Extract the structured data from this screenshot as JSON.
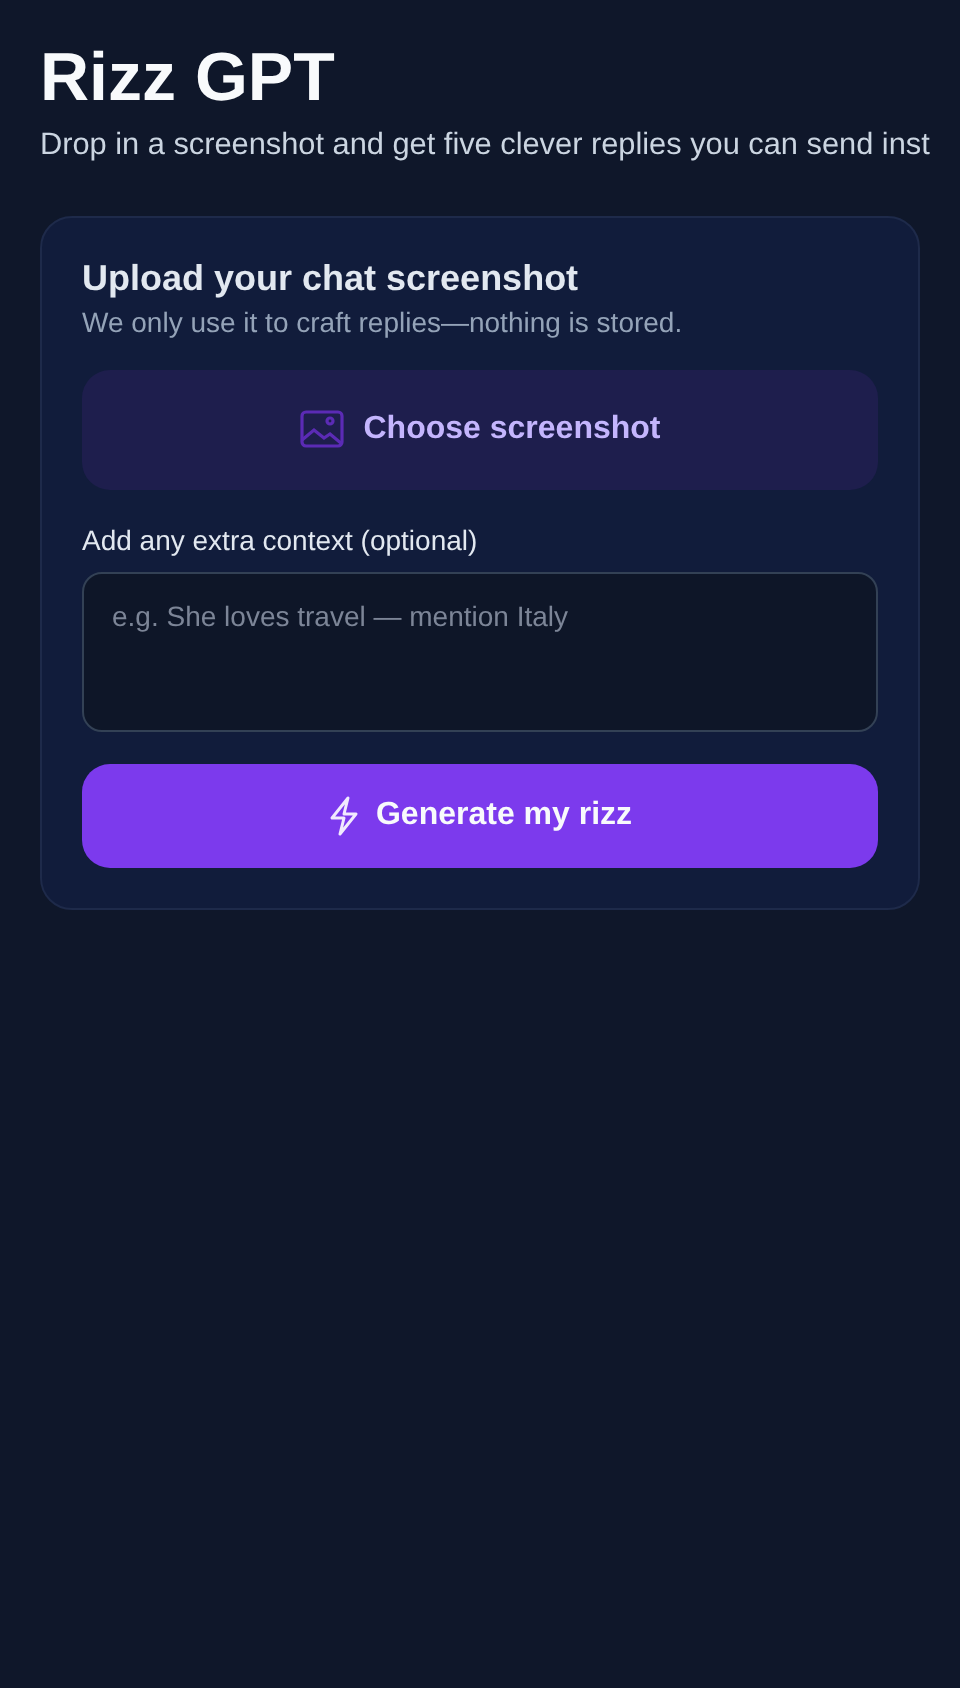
{
  "header": {
    "title": "Rizz GPT",
    "subtitle": "Drop in a screenshot and get five clever replies you can send inst"
  },
  "card": {
    "title": "Upload your chat screenshot",
    "subtitle": "We only use it to craft replies—nothing is stored.",
    "upload_button": "Choose screenshot",
    "context_label": "Add any extra context (optional)",
    "context_field": {
      "placeholder": "e.g. She loves travel — mention Italy"
    },
    "generate_button": "Generate my rizz"
  }
}
